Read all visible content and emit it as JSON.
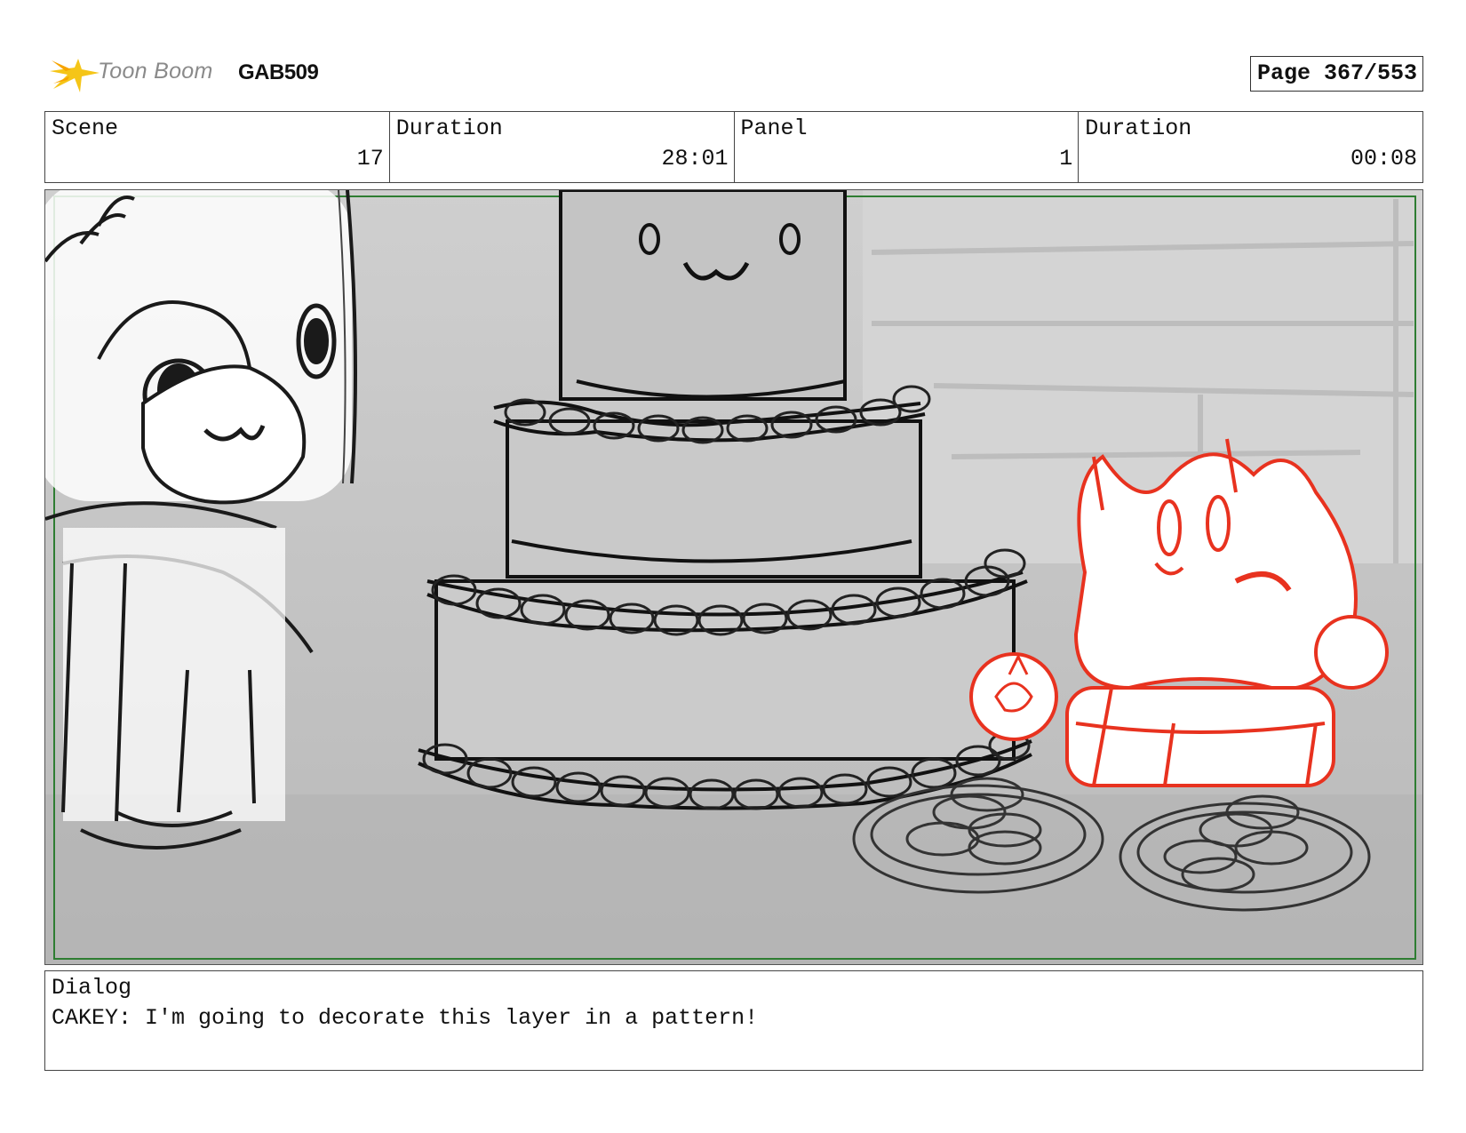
{
  "header": {
    "logo_text": "Toon Boom",
    "project_code": "GAB509",
    "page_label": "Page 367/553"
  },
  "info": {
    "scene_label": "Scene",
    "scene_value": "17",
    "scene_duration_label": "Duration",
    "scene_duration_value": "28:01",
    "panel_label": "Panel",
    "panel_value": "1",
    "panel_duration_label": "Duration",
    "panel_duration_value": "00:08"
  },
  "dialog": {
    "label": "Dialog",
    "text": "CAKEY: I'm going to decorate this layer in a pattern!"
  },
  "colors": {
    "logo_star": "#f5c518",
    "safe_frame": "#2e7d32",
    "cakey_sketch": "#e8321f",
    "sketch_lines": "#1a1a1a",
    "background_gray": "#c9c9c9"
  },
  "icons": {
    "logo": "toon-boom-star-icon"
  }
}
